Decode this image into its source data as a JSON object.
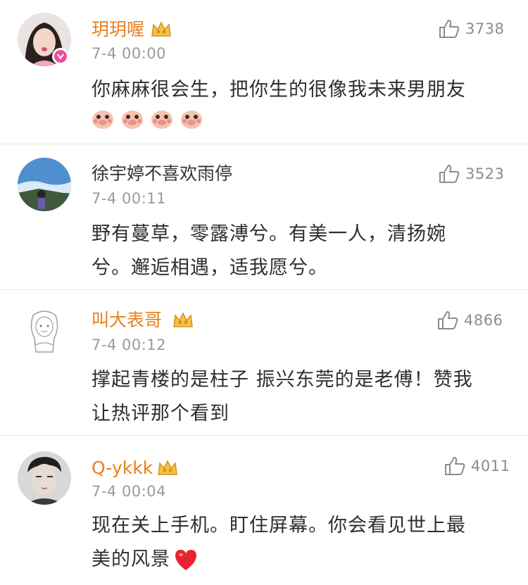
{
  "comments": [
    {
      "username": "玥玥喔",
      "timestamp": "7-4 00:00",
      "likes": "3738",
      "text_lines": [
        "你麻麻很会生，把你生的很像我未来男朋友"
      ],
      "vip": true,
      "verified_badge": true,
      "emoji_count": 4,
      "emoji_icon": "blushing-pig-emoji-icon"
    },
    {
      "username": "徐宇婷不喜欢雨停",
      "timestamp": "7-4 00:11",
      "likes": "3523",
      "text_lines": [
        "野有蔓草，零露溥兮。有美一人，清扬婉",
        "兮。邂逅相遇，适我愿兮。"
      ],
      "vip": false
    },
    {
      "username": "叫大表哥",
      "timestamp": "7-4 00:12",
      "likes": "4866",
      "text_lines": [
        "撑起青楼的是柱子 振兴东莞的是老傅！赞我",
        "让热评那个看到"
      ],
      "vip": true
    },
    {
      "username": "Q-ykkk",
      "timestamp": "7-4 00:04",
      "likes": "4011",
      "text_lines": [
        "现在关上手机。盯住屏幕。你会看见世上最",
        "美的风景"
      ],
      "vip": true,
      "trailing_icon": "red-heart-icon"
    }
  ],
  "colors": {
    "vip_name": "#e87f1c",
    "normal_name": "#333333",
    "timestamp": "#9a9a9a",
    "like": "#8c8c8c",
    "heart": "#e8232f",
    "badge": "#e84d9c"
  }
}
